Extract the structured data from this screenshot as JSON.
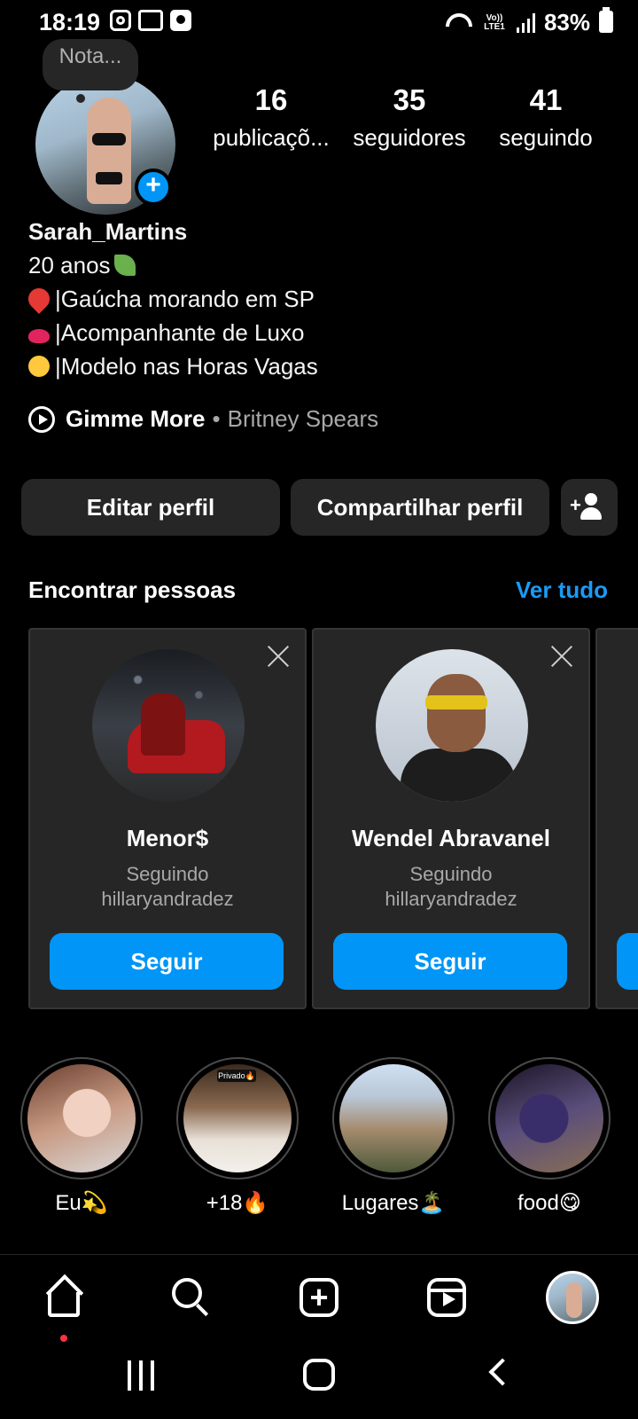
{
  "status_bar": {
    "time": "18:19",
    "lte": "Vo)) LTE1",
    "battery": "83%"
  },
  "profile": {
    "note": "Nota...",
    "stats": [
      {
        "value": "16",
        "label": "publicaçõ..."
      },
      {
        "value": "35",
        "label": "seguidores"
      },
      {
        "value": "41",
        "label": "seguindo"
      }
    ],
    "name": "Sarah_Martins",
    "bio_lines": [
      "20 anos",
      "|Gaúcha morando em SP",
      "|Acompanhante de Luxo",
      "|Modelo nas Horas Vagas"
    ],
    "music": {
      "song": "Gimme More",
      "separator": "•",
      "artist": "Britney Spears"
    }
  },
  "actions": {
    "edit": "Editar perfil",
    "share": "Compartilhar perfil"
  },
  "suggestions": {
    "title": "Encontrar pessoas",
    "see_all": "Ver tudo",
    "cards": [
      {
        "name": "Menor$",
        "sub1": "Seguindo",
        "sub2": "hillaryandradez",
        "button": "Seguir"
      },
      {
        "name": "Wendel Abravanel",
        "sub1": "Seguindo",
        "sub2": "hillaryandradez",
        "button": "Seguir"
      }
    ]
  },
  "highlights": [
    {
      "label": "Eu💫"
    },
    {
      "label": "+18🔥",
      "tag": "Privado🔥"
    },
    {
      "label": "Lugares🏝️"
    },
    {
      "label": "food😋"
    }
  ],
  "colors": {
    "accent": "#0095f6",
    "link": "#1a9bf6",
    "card_bg": "#262626",
    "notification_dot": "#ff3040"
  }
}
